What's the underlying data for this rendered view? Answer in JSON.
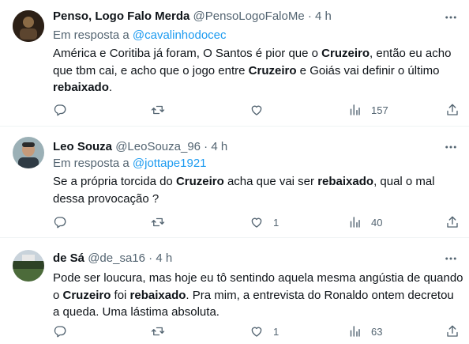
{
  "tweets": [
    {
      "name": "Penso, Logo Falo Merda",
      "handle": "@PensoLogoFaloMe",
      "time": "· 4 h",
      "reply_prefix": "Em resposta a",
      "reply_to": "@cavalinhodocec",
      "text": [
        {
          "t": "América e Coritiba já foram, O Santos é pior que o ",
          "b": false
        },
        {
          "t": "Cruzeiro",
          "b": true
        },
        {
          "t": ", então eu acho que tbm cai, e acho que o jogo entre ",
          "b": false
        },
        {
          "t": "Cruzeiro",
          "b": true
        },
        {
          "t": " e Goiás vai definir o último ",
          "b": false
        },
        {
          "t": "rebaixado",
          "b": true
        },
        {
          "t": ".",
          "b": false
        }
      ],
      "replies": "",
      "retweets": "",
      "likes": "",
      "views": "157",
      "avatar_color": "#3a2a1e"
    },
    {
      "name": "Leo Souza",
      "handle": "@LeoSouza_96",
      "time": "· 4 h",
      "reply_prefix": "Em resposta a",
      "reply_to": "@jottape1921",
      "text": [
        {
          "t": "Se a própria torcida do ",
          "b": false
        },
        {
          "t": "Cruzeiro",
          "b": true
        },
        {
          "t": " acha que vai ser ",
          "b": false
        },
        {
          "t": "rebaixado",
          "b": true
        },
        {
          "t": ", qual o mal dessa provocação ?",
          "b": false
        }
      ],
      "replies": "",
      "retweets": "",
      "likes": "1",
      "views": "40",
      "avatar_color": "#6b7f86"
    },
    {
      "name": "de Sá",
      "handle": "@de_sa16",
      "time": "· 4 h",
      "reply_prefix": "",
      "reply_to": "",
      "text": [
        {
          "t": "Pode ser loucura, mas hoje eu tô sentindo aquela mesma angústia de quando o ",
          "b": false
        },
        {
          "t": "Cruzeiro",
          "b": true
        },
        {
          "t": " foi ",
          "b": false
        },
        {
          "t": "rebaixado",
          "b": true
        },
        {
          "t": ". Pra mim, a entrevista do Ronaldo ontem decretou a queda. Uma lástima absoluta.",
          "b": false
        }
      ],
      "replies": "",
      "retweets": "",
      "likes": "1",
      "views": "63",
      "avatar_color": "#3f5a3a"
    }
  ],
  "icons": {
    "more": "more-icon",
    "reply": "reply-icon",
    "retweet": "retweet-icon",
    "like": "like-icon",
    "views": "views-icon",
    "share": "share-icon"
  }
}
